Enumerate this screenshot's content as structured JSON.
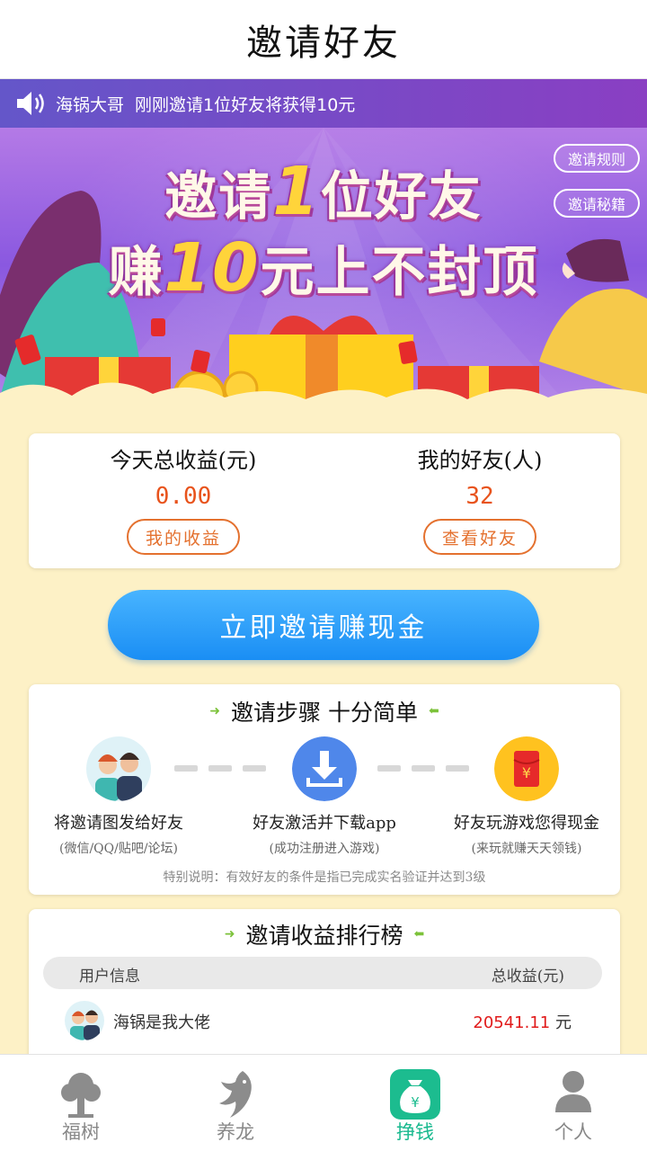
{
  "header": {
    "title": "邀请好友"
  },
  "notice": {
    "name": "海锅大哥",
    "message": "刚刚邀请1位好友将获得10元"
  },
  "banner": {
    "line1_pre": "邀请",
    "line1_num": "1",
    "line1_post": "位好友",
    "line2_pre": "赚",
    "line2_num": "10",
    "line2_post": "元上不封顶",
    "rules_button": "邀请规则",
    "secrets_button": "邀请秘籍"
  },
  "stats": {
    "income_label": "今天总收益(元)",
    "income_value": "0.00",
    "income_button": "我的收益",
    "friends_label": "我的好友(人)",
    "friends_value": "32",
    "friends_button": "查看好友"
  },
  "cta": {
    "label": "立即邀请赚现金"
  },
  "steps": {
    "title": "邀请步骤 十分简单",
    "items": [
      {
        "title": "将邀请图发给好友",
        "sub": "(微信/QQ/贴吧/论坛)",
        "icon": "friends-avatar-icon"
      },
      {
        "title": "好友激活并下载app",
        "sub": "(成功注册进入游戏)",
        "icon": "download-icon"
      },
      {
        "title": "好友玩游戏您得现金",
        "sub": "(来玩就赚天天领钱)",
        "icon": "red-envelope-icon"
      }
    ],
    "note": "特别说明：有效好友的条件是指已完成实名验证并达到3级"
  },
  "ranking": {
    "title": "邀请收益排行榜",
    "col_user": "用户信息",
    "col_income": "总收益(元)",
    "rows": [
      {
        "name": "海锅是我大佬",
        "amount": "20541.11",
        "unit": "元"
      }
    ]
  },
  "tabbar": {
    "items": [
      {
        "label": "福树",
        "icon": "tree-icon"
      },
      {
        "label": "养龙",
        "icon": "dragon-icon"
      },
      {
        "label": "挣钱",
        "icon": "money-bag-icon",
        "active": true
      },
      {
        "label": "个人",
        "icon": "person-icon"
      }
    ]
  },
  "colors": {
    "accent_blue": "#1a8ef4",
    "accent_orange": "#e4712f",
    "active_green": "#19b98f",
    "page_bg": "#fdf1c6"
  }
}
